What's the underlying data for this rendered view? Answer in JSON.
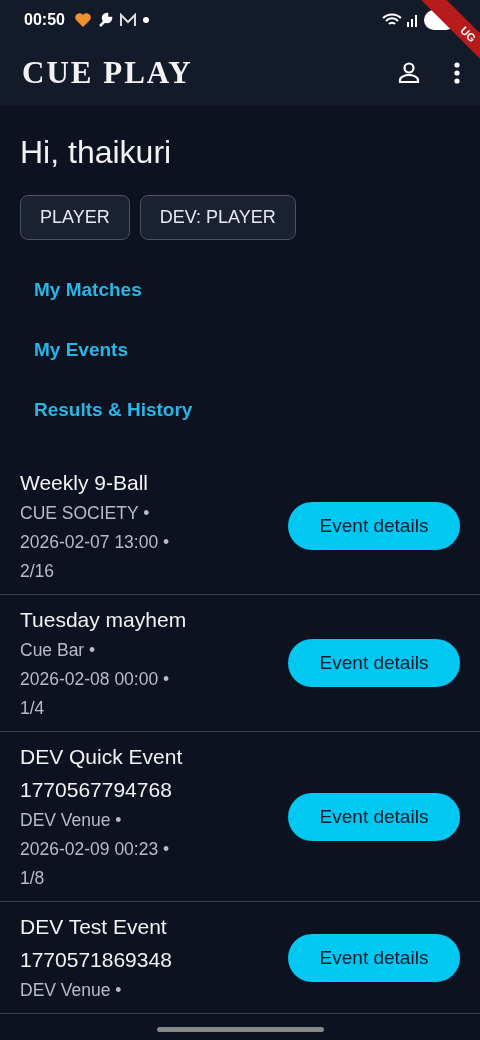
{
  "status_bar": {
    "time": "00:50",
    "debug_banner": "UG"
  },
  "app_bar": {
    "title": "CUE PLAY"
  },
  "greeting": "Hi, thaikuri",
  "roles": [
    {
      "label": "PLAYER"
    },
    {
      "label": "DEV: PLAYER"
    }
  ],
  "links": [
    {
      "label": "My Matches"
    },
    {
      "label": "My Events"
    },
    {
      "label": "Results & History"
    }
  ],
  "events": [
    {
      "title": "Weekly 9-Ball",
      "details": [
        "CUE SOCIETY •",
        "2026-02-07 13:00 •",
        "2/16"
      ],
      "button": "Event details"
    },
    {
      "title": "Tuesday mayhem",
      "details": [
        "Cue Bar •",
        "2026-02-08 00:00 •",
        "1/4"
      ],
      "button": "Event details"
    },
    {
      "title": "DEV Quick Event 1770567794768",
      "details": [
        "DEV Venue •",
        "2026-02-09 00:23 •",
        "1/8"
      ],
      "button": "Event details"
    },
    {
      "title": "DEV Test Event 1770571869348",
      "details": [
        "DEV Venue •"
      ],
      "button": "Event details"
    }
  ]
}
